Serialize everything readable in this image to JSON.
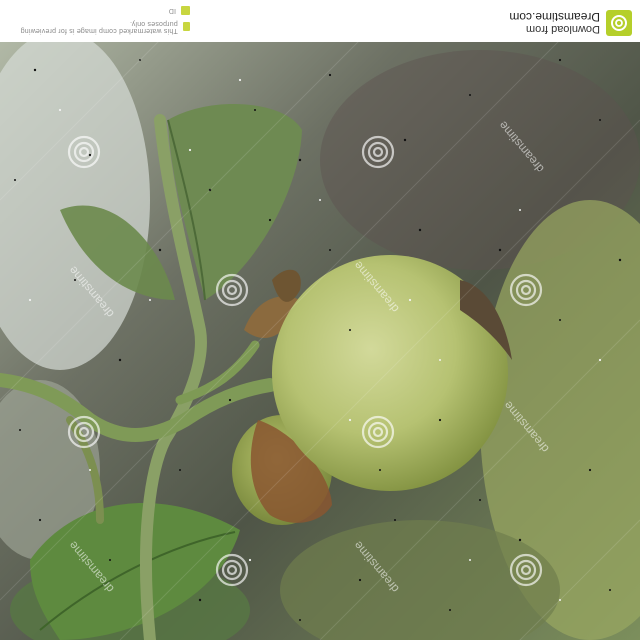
{
  "image": {
    "subject": "unripe green mangosteen fruit on a branch",
    "watermark_text": "dreamstime",
    "banner": {
      "line1": "Download from",
      "line2": "Dreamstime.com",
      "meta_line1": "This watermarked comp image is for previewing purposes only.",
      "meta_line2": "ID"
    }
  },
  "colors": {
    "leaf": "#6e8a48",
    "fruit": "#b9c779",
    "background": "#6f7a62",
    "brand_accent": "#b5cf2a"
  }
}
